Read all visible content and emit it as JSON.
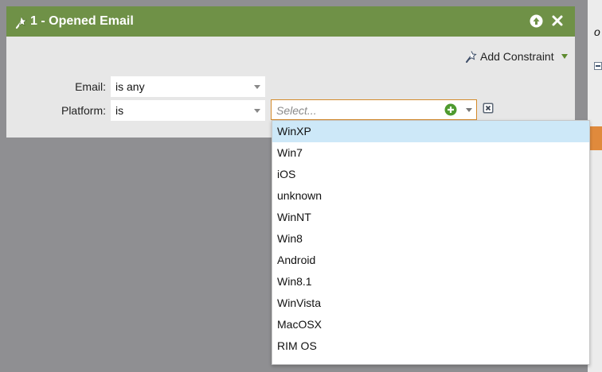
{
  "panel": {
    "title": "1 - Opened Email",
    "add_constraint_label": "Add Constraint"
  },
  "filters": {
    "email": {
      "label": "Email:",
      "value": "is any"
    },
    "platform": {
      "label": "Platform:",
      "value": "is"
    }
  },
  "platform_values": {
    "placeholder": "Select..."
  },
  "dropdown": {
    "selected_index": 0,
    "items": [
      {
        "label": "WinXP"
      },
      {
        "label": "Win7"
      },
      {
        "label": "iOS"
      },
      {
        "label": "unknown"
      },
      {
        "label": "WinNT"
      },
      {
        "label": "Win8"
      },
      {
        "label": "Android"
      },
      {
        "label": "Win8.1"
      },
      {
        "label": "WinVista"
      },
      {
        "label": "MacOSX"
      },
      {
        "label": "RIM OS"
      }
    ]
  },
  "background_panel": {
    "partial_text": "o"
  },
  "colors": {
    "header_green": "#6f9147",
    "panel_bg": "#e7e7e7",
    "overlay_bg": "#8f8f92",
    "highlight": "#cde8f8",
    "focus_border": "#d48b2c",
    "accent_orange": "#e08a3c"
  },
  "icons": {
    "header_left": "wand-icon",
    "move_up": "arrow-up-circle-icon",
    "close": "close-icon",
    "add_value": "plus-circle-icon",
    "remove": "remove-box-icon"
  }
}
